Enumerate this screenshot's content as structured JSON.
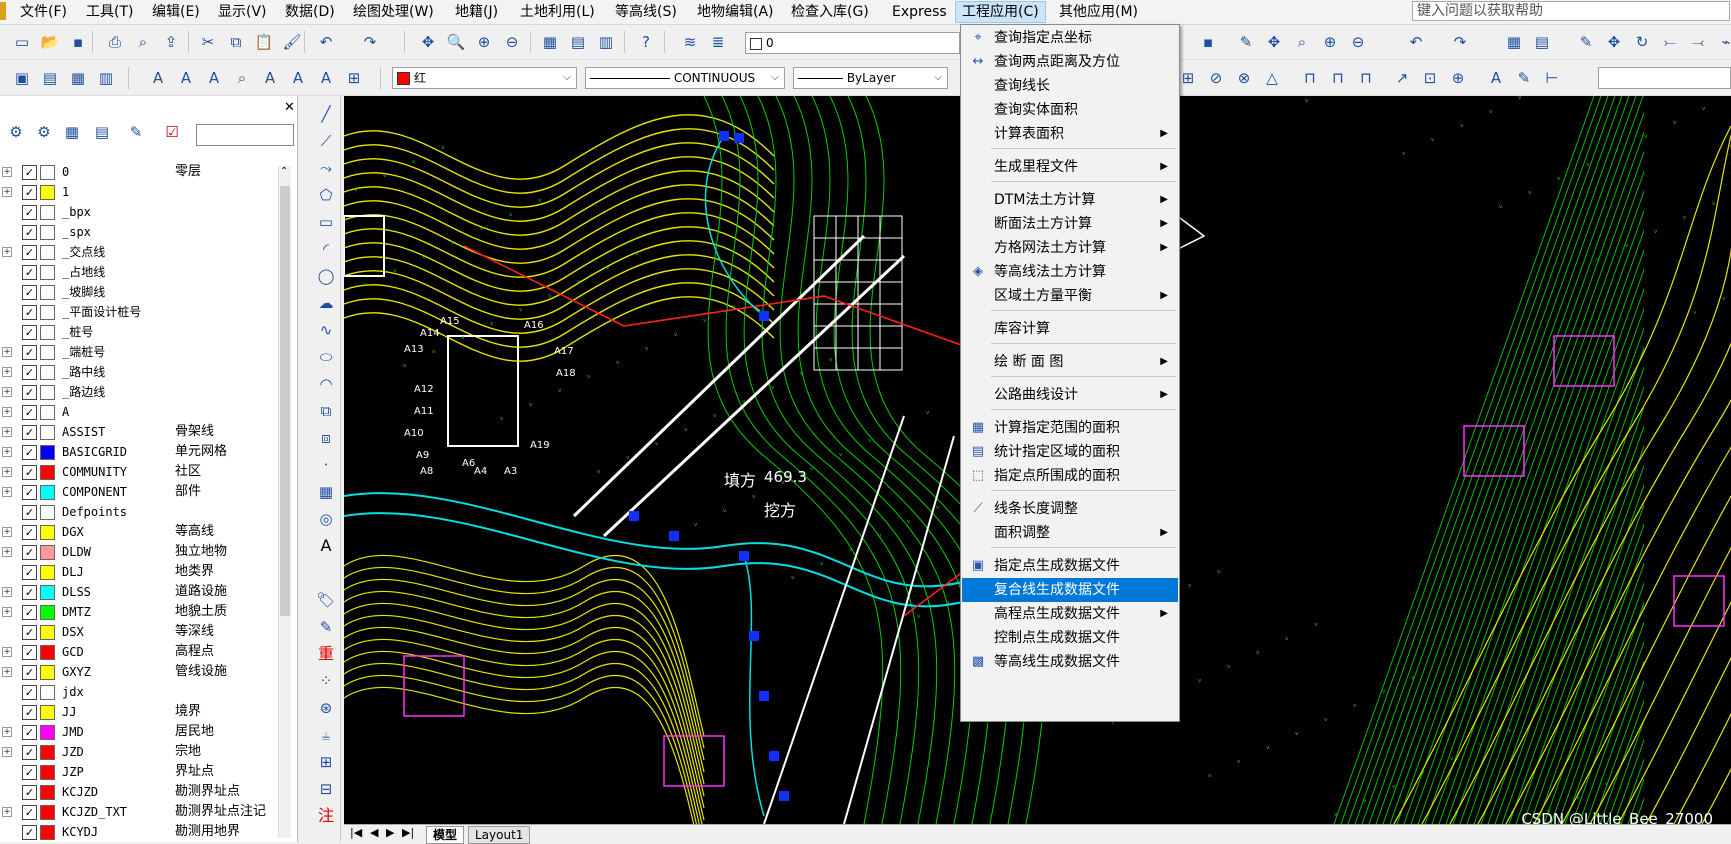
{
  "menubar": {
    "items": [
      "文件(F)",
      "工具(T)",
      "编辑(E)",
      "显示(V)",
      "数据(D)",
      "绘图处理(W)",
      "地籍(J)",
      "土地利用(L)",
      "等高线(S)",
      "地物编辑(A)",
      "检查入库(G)",
      "Express",
      "工程应用(C)",
      "其他应用(M)"
    ],
    "active": "工程应用(C)",
    "help_placeholder": "键入问题以获取帮助"
  },
  "toolbar": {
    "layer_value": "0",
    "color_value": "红",
    "linetype_value": "CONTINUOUS",
    "lineweight_value": "ByLayer",
    "colors": {
      "red": "#ff0000"
    }
  },
  "layers": [
    {
      "name": "0",
      "desc": "零层",
      "color": "#ffffff"
    },
    {
      "name": "1",
      "desc": "",
      "color": "#ffff00"
    },
    {
      "name": "_bpx",
      "desc": "",
      "color": "#ffffff"
    },
    {
      "name": "_spx",
      "desc": "",
      "color": "#ffffff"
    },
    {
      "name": "_交点线",
      "desc": "",
      "color": "#ffffff"
    },
    {
      "name": "_占地线",
      "desc": "",
      "color": "#ffffff"
    },
    {
      "name": "_坡脚线",
      "desc": "",
      "color": "#ffffff"
    },
    {
      "name": "_平面设计桩号",
      "desc": "",
      "color": "#ffffff"
    },
    {
      "name": "_桩号",
      "desc": "",
      "color": "#ffffff"
    },
    {
      "name": "_端桩号",
      "desc": "",
      "color": "#ffffff"
    },
    {
      "name": "_路中线",
      "desc": "",
      "color": "#ffffff"
    },
    {
      "name": "_路边线",
      "desc": "",
      "color": "#ffffff"
    },
    {
      "name": "A",
      "desc": "",
      "color": "#ffffff"
    },
    {
      "name": "ASSIST",
      "desc": "骨架线",
      "color": "#ffffff"
    },
    {
      "name": "BASICGRID",
      "desc": "单元网格",
      "color": "#0000ff"
    },
    {
      "name": "COMMUNITY",
      "desc": "社区",
      "color": "#ff0000"
    },
    {
      "name": "COMPONENT",
      "desc": "部件",
      "color": "#00ffff"
    },
    {
      "name": "Defpoints",
      "desc": "",
      "color": "#ffffff"
    },
    {
      "name": "DGX",
      "desc": "等高线",
      "color": "#ffff00"
    },
    {
      "name": "DLDW",
      "desc": "独立地物",
      "color": "#ff9999"
    },
    {
      "name": "DLJ",
      "desc": "地类界",
      "color": "#ffff00"
    },
    {
      "name": "DLSS",
      "desc": "道路设施",
      "color": "#00ffff"
    },
    {
      "name": "DMTZ",
      "desc": "地貌土质",
      "color": "#00ff00"
    },
    {
      "name": "DSX",
      "desc": "等深线",
      "color": "#ffff00"
    },
    {
      "name": "GCD",
      "desc": "高程点",
      "color": "#ff0000"
    },
    {
      "name": "GXYZ",
      "desc": "管线设施",
      "color": "#ffff00"
    },
    {
      "name": "jdx",
      "desc": "",
      "color": "#ffffff"
    },
    {
      "name": "JJ",
      "desc": "境界",
      "color": "#ffff00"
    },
    {
      "name": "JMD",
      "desc": "居民地",
      "color": "#ff00ff"
    },
    {
      "name": "JZD",
      "desc": "宗地",
      "color": "#ff0000"
    },
    {
      "name": "JZP",
      "desc": "界址点",
      "color": "#ff0000"
    },
    {
      "name": "KCJZD",
      "desc": "勘测界址点",
      "color": "#ff0000"
    },
    {
      "name": "KCJZD_TXT",
      "desc": "勘测界址点注记",
      "color": "#ff0000"
    },
    {
      "name": "KCYDJ",
      "desc": "勘测用地界",
      "color": "#ff0000"
    }
  ],
  "dropdown": {
    "items": [
      {
        "label": "查询指定点坐标",
        "sub": false,
        "icon": "query-point-icon",
        "glyph": "⌖"
      },
      {
        "label": "查询两点距离及方位",
        "sub": false,
        "icon": "distance-icon",
        "glyph": "↔"
      },
      {
        "label": "查询线长",
        "sub": false,
        "icon": "",
        "glyph": ""
      },
      {
        "label": "查询实体面积",
        "sub": false,
        "icon": "",
        "glyph": ""
      },
      {
        "label": "计算表面积",
        "sub": true,
        "icon": "",
        "glyph": ""
      },
      {
        "label": "生成里程文件",
        "sub": true,
        "icon": "",
        "glyph": ""
      },
      {
        "label": "DTM法土方计算",
        "sub": true,
        "icon": "",
        "glyph": ""
      },
      {
        "label": "断面法土方计算",
        "sub": true,
        "icon": "",
        "glyph": ""
      },
      {
        "label": "方格网法土方计算",
        "sub": true,
        "icon": "",
        "glyph": ""
      },
      {
        "label": "等高线法土方计算",
        "sub": false,
        "icon": "contour-earthwork-icon",
        "glyph": "◈"
      },
      {
        "label": "区域土方量平衡",
        "sub": true,
        "icon": "",
        "glyph": ""
      },
      {
        "label": "库容计算",
        "sub": false,
        "icon": "",
        "glyph": ""
      },
      {
        "label": "绘 断 面 图",
        "sub": true,
        "icon": "",
        "glyph": ""
      },
      {
        "label": "公路曲线设计",
        "sub": true,
        "icon": "",
        "glyph": ""
      },
      {
        "label": "计算指定范围的面积",
        "sub": false,
        "icon": "range-area-icon",
        "glyph": "▦"
      },
      {
        "label": "统计指定区域的面积",
        "sub": false,
        "icon": "region-area-icon",
        "glyph": "▤"
      },
      {
        "label": "指定点所围成的面积",
        "sub": false,
        "icon": "points-area-icon",
        "glyph": "⬚"
      },
      {
        "label": "线条长度调整",
        "sub": false,
        "icon": "line-length-icon",
        "glyph": "⟋"
      },
      {
        "label": "面积调整",
        "sub": true,
        "icon": "",
        "glyph": ""
      },
      {
        "label": "指定点生成数据文件",
        "sub": false,
        "icon": "point-data-file-icon",
        "glyph": "▣"
      },
      {
        "label": "复合线生成数据文件",
        "sub": false,
        "icon": "",
        "glyph": ""
      },
      {
        "label": "高程点生成数据文件",
        "sub": true,
        "icon": "",
        "glyph": ""
      },
      {
        "label": "控制点生成数据文件",
        "sub": false,
        "icon": "",
        "glyph": ""
      },
      {
        "label": "等高线生成数据文件",
        "sub": false,
        "icon": "contour-data-file-icon",
        "glyph": "▩"
      }
    ],
    "highlighted": "复合线生成数据文件"
  },
  "canvas": {
    "labels": [
      "填方",
      "挖方",
      "469.3"
    ],
    "point_labels": [
      "A15",
      "A16",
      "A14",
      "A13",
      "A17",
      "A18",
      "A12",
      "A11",
      "A10",
      "A9",
      "A19",
      "A8",
      "A6",
      "A4",
      "A3"
    ]
  },
  "tabs": [
    "模型",
    "Layout1"
  ],
  "watermark": "CSDN @Little_Bee_27000",
  "draw_toolbar": {
    "redraw_label": "重",
    "annotate_label": "注",
    "text_label": "A"
  }
}
